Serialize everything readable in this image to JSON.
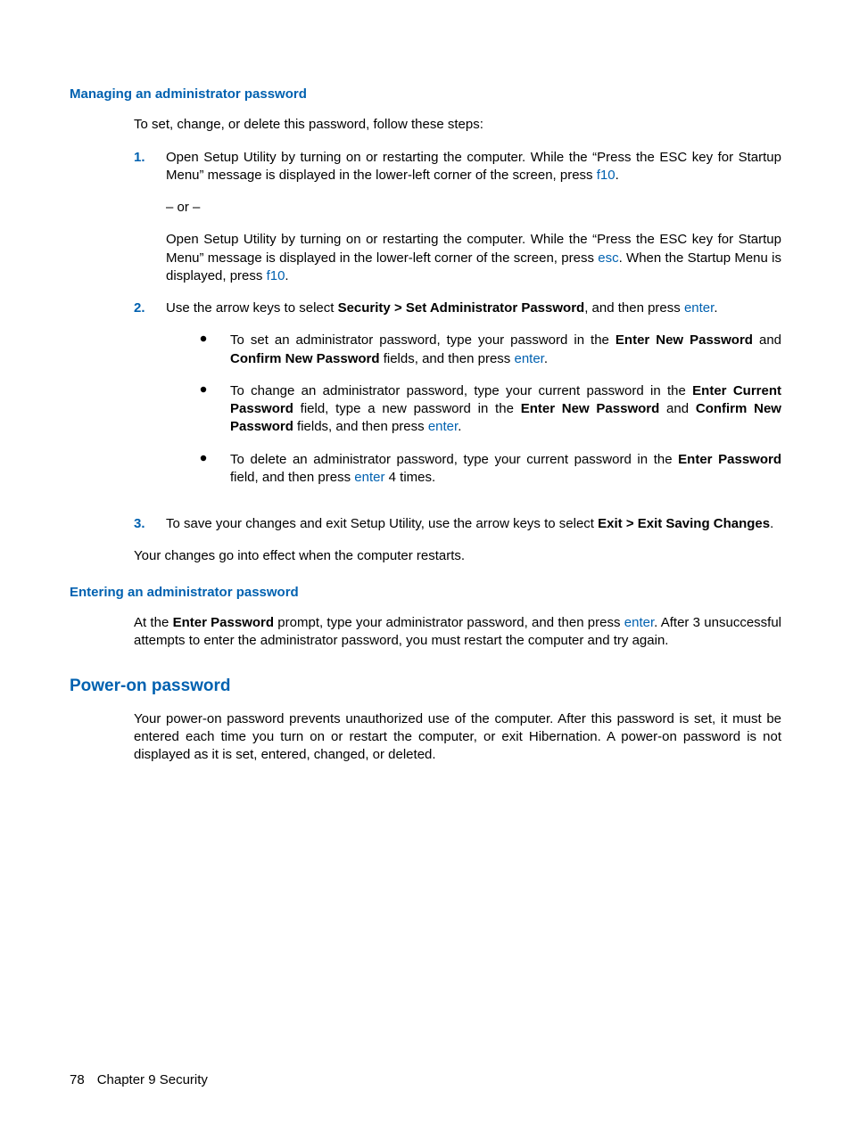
{
  "section1": {
    "heading": "Managing an administrator password",
    "intro": "To set, change, or delete this password, follow these steps:",
    "step1": {
      "num": "1.",
      "p1a": "Open Setup Utility by turning on or restarting the computer. While the “Press the ESC key for Startup Menu” message is displayed in the lower-left corner of the screen, press ",
      "key1": "f10",
      "p1b": ".",
      "or": "– or –",
      "p2a": "Open Setup Utility by turning on or restarting the computer. While the “Press the ESC key for Startup Menu” message is displayed in the lower-left corner of the screen, press ",
      "key2": "esc",
      "p2b": ". When the Startup Menu is displayed, press ",
      "key3": "f10",
      "p2c": "."
    },
    "step2": {
      "num": "2.",
      "t1": "Use the arrow keys to select ",
      "b1": "Security > Set Administrator Password",
      "t2": ", and then press ",
      "key": "enter",
      "t3": ".",
      "bullets": [
        {
          "t1": "To set an administrator password, type your password in the ",
          "b1": "Enter New Password",
          "t2": " and ",
          "b2": "Confirm New Password",
          "t3": " fields, and then press ",
          "key": "enter",
          "t4": "."
        },
        {
          "t1": "To change an administrator password, type your current password in the ",
          "b1": "Enter Current Password",
          "t2": " field, type a new password in the ",
          "b2": "Enter New Password",
          "t3": " and ",
          "b3": "Confirm New Password",
          "t4": " fields, and then press ",
          "key": "enter",
          "t5": "."
        },
        {
          "t1": "To delete an administrator password, type your current password in the ",
          "b1": "Enter Password",
          "t2": " field, and then press ",
          "key": "enter",
          "t3": " 4 times."
        }
      ]
    },
    "step3": {
      "num": "3.",
      "t1": "To save your changes and exit Setup Utility, use the arrow keys to select ",
      "b1": "Exit > Exit Saving Changes",
      "t2": "."
    },
    "outro": "Your changes go into effect when the computer restarts."
  },
  "section2": {
    "heading": "Entering an administrator password",
    "p": {
      "t1": "At the ",
      "b1": "Enter Password",
      "t2": " prompt, type your administrator password, and then press ",
      "key": "enter",
      "t3": ". After 3 unsuccessful attempts to enter the administrator password, you must restart the computer and try again."
    }
  },
  "section3": {
    "heading": "Power-on password",
    "p": "Your power-on password prevents unauthorized use of the computer. After this password is set, it must be entered each time you turn on or restart the computer, or exit Hibernation. A power-on password is not displayed as it is set, entered, changed, or deleted."
  },
  "footer": {
    "page": "78",
    "chapter": "Chapter 9   Security"
  }
}
